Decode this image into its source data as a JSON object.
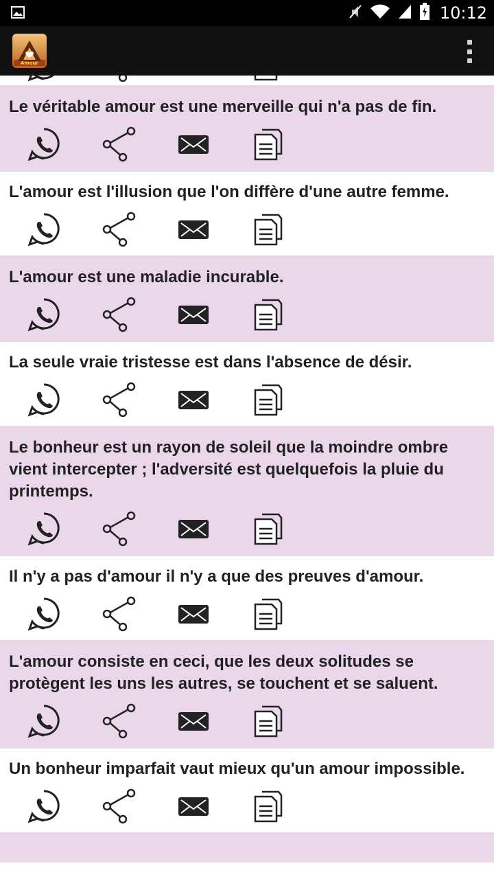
{
  "status_bar": {
    "time": "10:12",
    "icons": [
      "image-icon",
      "mute-icon",
      "wifi-icon",
      "signal-icon",
      "battery-icon"
    ]
  },
  "app_bar": {
    "logo_text": "Amour",
    "icons": [
      "app-logo-icon",
      "overflow-menu-icon"
    ]
  },
  "action_icons": [
    "whatsapp-icon",
    "share-icon",
    "email-icon",
    "copy-icon"
  ],
  "colors": {
    "status_bar": "#000000",
    "app_bar": "#111111",
    "row_tint": "#ead8ea",
    "row_plain": "#ffffff",
    "text": "#222222"
  },
  "quotes": [
    {
      "text": "Le véritable amour est une merveille qui n'a pas de fin."
    },
    {
      "text": "L'amour est l'illusion que l'on diffère d'une autre femme."
    },
    {
      "text": "L'amour est une maladie incurable."
    },
    {
      "text": "La seule vraie tristesse est dans l'absence de désir."
    },
    {
      "text": "Le bonheur est un rayon de soleil que la moindre ombre vient intercepter ; l'adversité est quelquefois la pluie du printemps."
    },
    {
      "text": "Il n'y a pas d'amour il n'y a que des preuves d'amour."
    },
    {
      "text": "L'amour consiste en ceci, que les deux solitudes se protègent les uns les autres, se touchent et se saluent."
    },
    {
      "text": "Un bonheur imparfait vaut mieux qu'un amour impossible."
    }
  ]
}
